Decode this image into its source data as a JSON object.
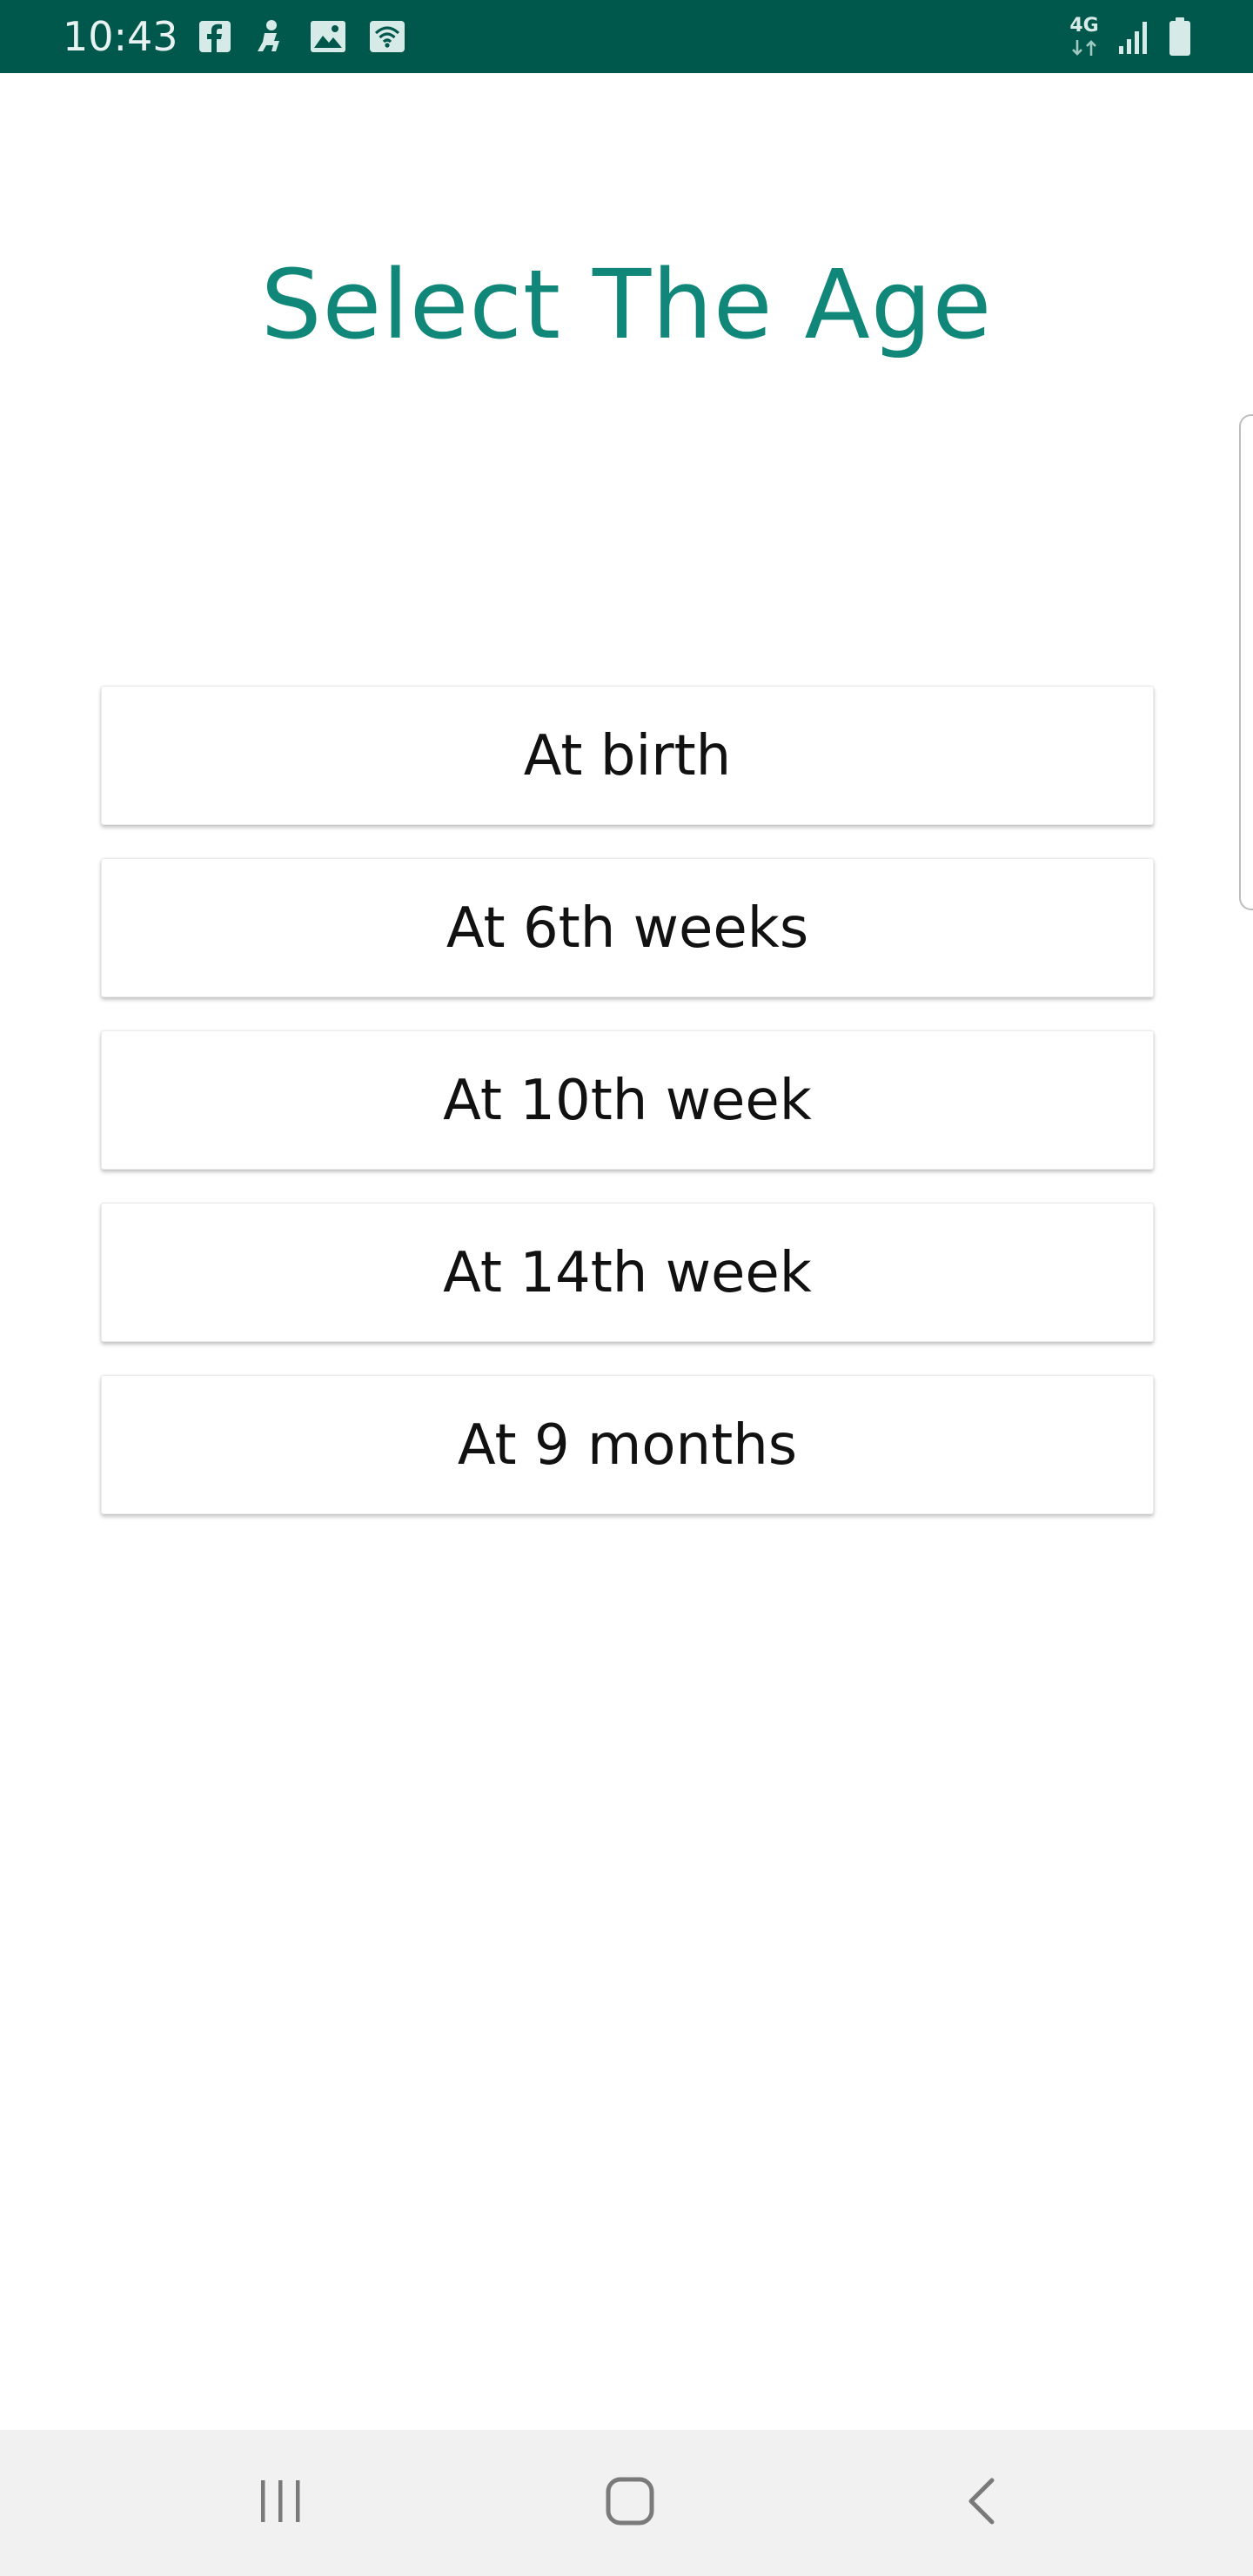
{
  "status_bar": {
    "time": "10:43",
    "network_label": "4G",
    "left_icons": [
      "facebook-icon",
      "notification-figure-icon",
      "gallery-icon",
      "wifi-calling-icon"
    ],
    "right_icons": [
      "4g-data-icon",
      "signal-icon",
      "battery-icon"
    ],
    "background_color": "#00574b"
  },
  "header": {
    "title": "Select The Age",
    "title_color": "#11877a"
  },
  "age_options": [
    {
      "label": "At birth"
    },
    {
      "label": "At 6th weeks"
    },
    {
      "label": "At 10th week"
    },
    {
      "label": "At 14th week"
    },
    {
      "label": "At 9 months"
    }
  ],
  "nav_bar": {
    "buttons": [
      "recents-icon",
      "home-icon",
      "back-icon"
    ],
    "background_color": "#f1f1f1"
  }
}
